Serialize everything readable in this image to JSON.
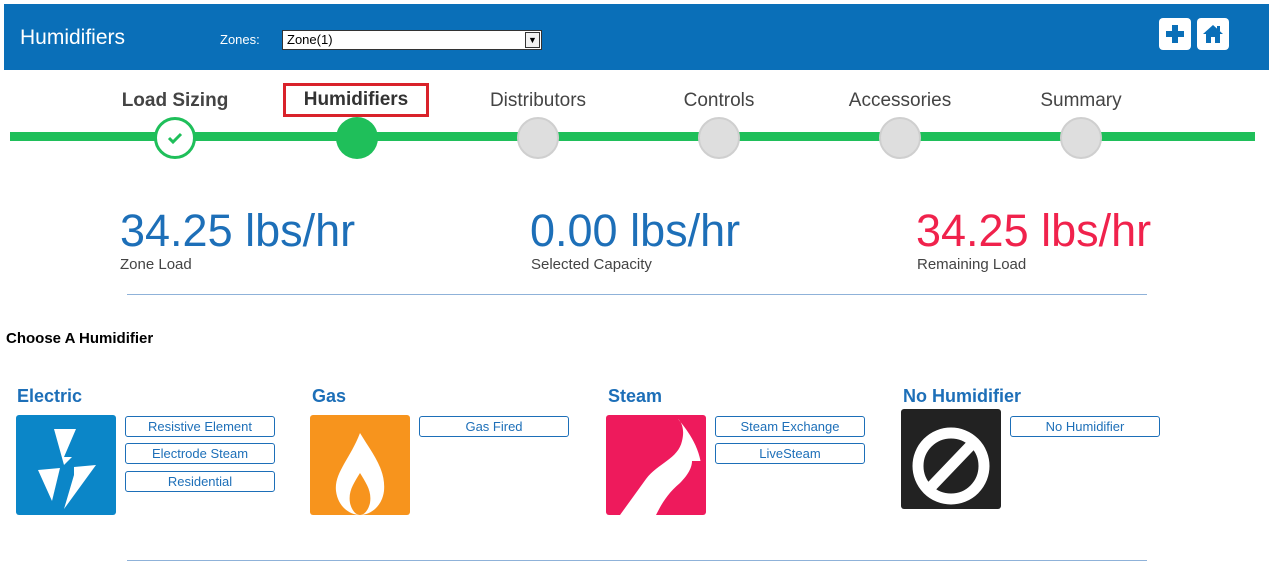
{
  "header": {
    "title": "Humidifiers",
    "zones_label": "Zones:",
    "zone_selected": "Zone(1)",
    "add_icon": "plus-icon",
    "home_icon": "home-icon"
  },
  "steps": [
    {
      "label": "Load Sizing",
      "state": "done"
    },
    {
      "label": "Humidifiers",
      "state": "current"
    },
    {
      "label": "Distributors",
      "state": "pending"
    },
    {
      "label": "Controls",
      "state": "pending"
    },
    {
      "label": "Accessories",
      "state": "pending"
    },
    {
      "label": "Summary",
      "state": "pending"
    }
  ],
  "metrics": [
    {
      "value": "34.25 lbs/hr",
      "label": "Zone Load"
    },
    {
      "value": "0.00 lbs/hr",
      "label": "Selected Capacity"
    },
    {
      "value": "34.25 lbs/hr",
      "label": "Remaining Load",
      "color": "#f0224c"
    }
  ],
  "section_title": "Choose A Humidifier",
  "categories": [
    {
      "title": "Electric",
      "icon": "lightning-bolt-icon",
      "color": "#0b86c8",
      "options": [
        "Resistive Element",
        "Electrode Steam",
        "Residential"
      ]
    },
    {
      "title": "Gas",
      "icon": "flame-icon",
      "color": "#f7941d",
      "options": [
        "Gas Fired"
      ]
    },
    {
      "title": "Steam",
      "icon": "steam-icon",
      "color": "#ee1a5c",
      "options": [
        "Steam Exchange",
        "LiveSteam"
      ]
    },
    {
      "title": "No Humidifier",
      "icon": "prohibited-icon",
      "color": "#222222",
      "options": [
        "No Humidifier"
      ]
    }
  ],
  "colors": {
    "brand": "#0a6fb8",
    "progress": "#1fbf5a",
    "accent_text": "#1d6fb8",
    "alert": "#f0224c"
  }
}
